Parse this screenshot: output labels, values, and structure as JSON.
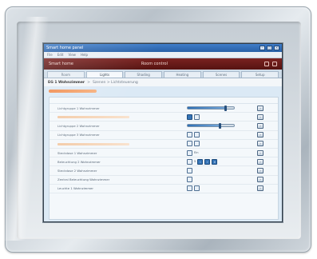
{
  "window": {
    "title": "Smart home panel",
    "menu": [
      "File",
      "Edit",
      "View",
      "Help"
    ]
  },
  "app_header": {
    "left": "Smart home",
    "center": "Room control"
  },
  "tabs": [
    {
      "label": "Room",
      "active": false
    },
    {
      "label": "Lights",
      "active": true
    },
    {
      "label": "Shading",
      "active": false
    },
    {
      "label": "Heating",
      "active": false
    },
    {
      "label": "Scenes",
      "active": false
    },
    {
      "label": "Setup",
      "active": false
    }
  ],
  "breadcrumb": {
    "main": "EG 1 Wohnzimmer",
    "sep": ">",
    "sub": "Szenen > Lichtsteuerung"
  },
  "columns": {
    "name": "",
    "control": "",
    "action": ""
  },
  "rows": [
    {
      "label": "Lichtgruppe 1 Wohnzimmer",
      "highlight": false,
      "control": "slider",
      "level": 0.82
    },
    {
      "label": "",
      "highlight": true,
      "control": "toggle",
      "state": "on",
      "text": ""
    },
    {
      "label": "Lichtgruppe 2 Wohnzimmer",
      "highlight": false,
      "control": "slider",
      "level": 0.7
    },
    {
      "label": "Lichtgruppe 3 Wohnzimmer",
      "highlight": false,
      "control": "toggle",
      "state": "off",
      "text": ""
    },
    {
      "label": "",
      "highlight": true,
      "control": "toggle",
      "state": "off",
      "text": ""
    },
    {
      "label": "Steckdose 1 Wohnzimmer",
      "highlight": false,
      "control": "toggle-text",
      "state": "off",
      "text": "Ein"
    },
    {
      "label": "Beleuchtung 2 Wohnzimmer",
      "highlight": false,
      "control": "stepper",
      "text": "5"
    },
    {
      "label": "Steckdose 2 Wohnzimmer",
      "highlight": false,
      "control": "single",
      "state": "off",
      "text": ""
    },
    {
      "label": "Zentral Beleuchtung Wohnzimmer",
      "highlight": false,
      "control": "single",
      "state": "off",
      "text": ""
    },
    {
      "label": "Leuchte 1 Wohnzimmer",
      "highlight": false,
      "control": "toggle",
      "state": "off",
      "text": ""
    }
  ],
  "icons": {
    "close": "close-icon",
    "minimize": "minimize-icon",
    "maximize": "maximize-icon"
  },
  "colors": {
    "header": "#6a1b19",
    "accent": "#3574b7",
    "highlight": "#f08a4b"
  }
}
